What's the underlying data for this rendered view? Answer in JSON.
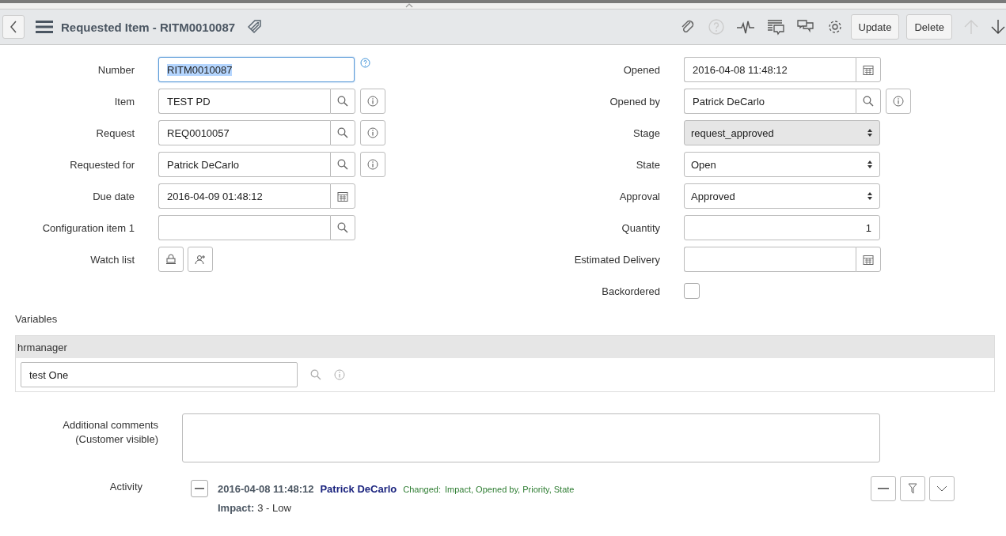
{
  "header": {
    "title": "Requested Item - RITM0010087",
    "buttons": [
      "Update",
      "Delete"
    ]
  },
  "left_fields": [
    {
      "label": "Number",
      "kind": "text",
      "value": "RITM0010087",
      "focused": true,
      "help": true
    },
    {
      "label": "Item",
      "kind": "reference",
      "value": "TEST PD",
      "info": true
    },
    {
      "label": "Request",
      "kind": "reference",
      "value": "REQ0010057",
      "info": true
    },
    {
      "label": "Requested for",
      "kind": "reference",
      "value": "Patrick DeCarlo",
      "info": true
    },
    {
      "label": "Due date",
      "kind": "date",
      "value": "2016-04-09 01:48:12"
    },
    {
      "label": "Configuration item 1",
      "kind": "reference",
      "info": false
    },
    {
      "label": "Watch list",
      "kind": "watchlist"
    }
  ],
  "right_fields": [
    {
      "label": "Opened",
      "kind": "date",
      "value": "2016-04-08 11:48:12"
    },
    {
      "label": "Opened by",
      "kind": "reference",
      "value": "Patrick DeCarlo",
      "info": true
    },
    {
      "label": "Stage",
      "kind": "select",
      "value": "request_approved",
      "disabled": true
    },
    {
      "label": "State",
      "kind": "select",
      "value": "Open",
      "disabled": false
    },
    {
      "label": "Approval",
      "kind": "select",
      "value": "Approved",
      "disabled": false
    },
    {
      "label": "Quantity",
      "kind": "number",
      "value": "1"
    },
    {
      "label": "Estimated Delivery",
      "kind": "date"
    },
    {
      "label": "Backordered",
      "kind": "checkbox",
      "checked": false
    }
  ],
  "variables": {
    "title": "Variables",
    "section": "hrmanager",
    "value": "test One"
  },
  "comments": {
    "label": "Additional comments",
    "sublabel": "(Customer visible)"
  },
  "activity": {
    "label": "Activity",
    "entries": [
      {
        "timestamp": "2016-04-08 11:48:12",
        "user": "Patrick DeCarlo",
        "changed_label": "Changed:",
        "changed_fields": "Impact, Opened by, Priority, State",
        "detail_field": "Impact:",
        "detail_value": "3 - Low"
      }
    ]
  }
}
